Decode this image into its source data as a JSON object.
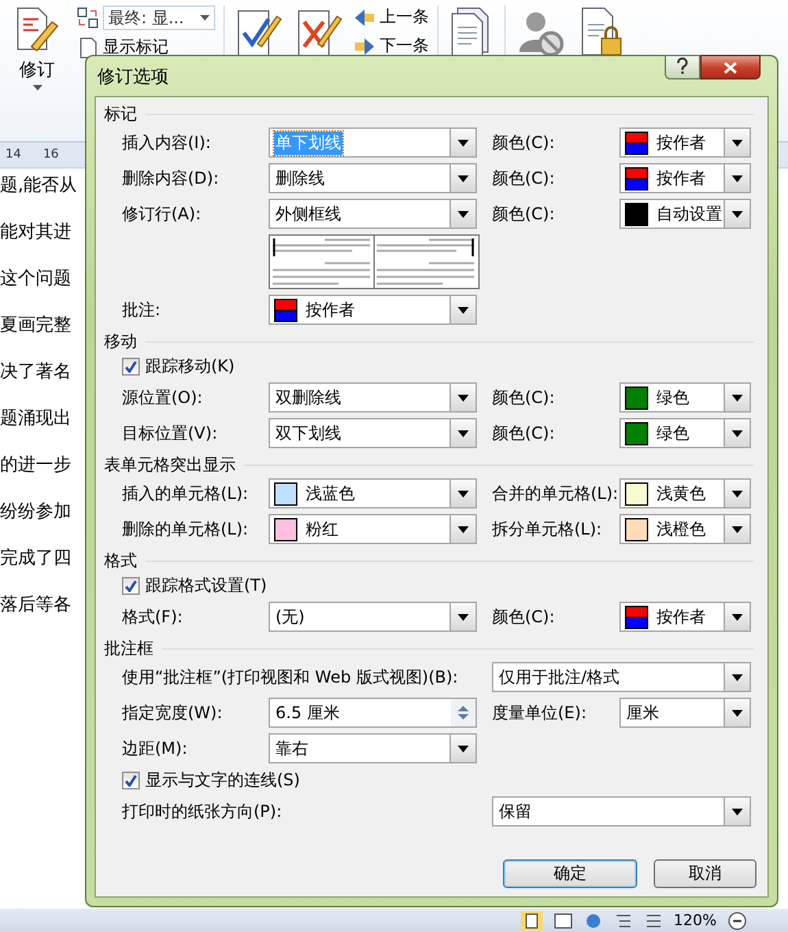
{
  "ribbon": {
    "track_button": {
      "label": "修订"
    },
    "markup_dropdown": {
      "value": "最终: 显..."
    },
    "show_markup": {
      "label": "显示标记"
    },
    "previous": {
      "label": "上一条"
    },
    "next": {
      "label": "下一条"
    }
  },
  "ruler": [
    "14",
    "16"
  ],
  "document_lines": [
    "题,能否从",
    "能对其进",
    "这个问题",
    "夏画完整",
    "决了著名",
    "题涌现出",
    "的进一步",
    "纷纷参加",
    "完成了四",
    "落后等各"
  ],
  "status_bar": {
    "zoom": "120%"
  },
  "dialog": {
    "title": "修订选项",
    "sections": [
      {
        "title": "标记",
        "rows": [
          {
            "kind": "pair",
            "label": "插入内容(I):",
            "field": {
              "value": "单下划线",
              "focused": true
            },
            "label2": "颜色(C):",
            "field2": {
              "value": "按作者",
              "swatch": {
                "kind": "split"
              }
            }
          },
          {
            "kind": "pair",
            "label": "删除内容(D):",
            "field": {
              "value": "删除线",
              "focused": false
            },
            "label2": "颜色(C):",
            "field2": {
              "value": "按作者",
              "swatch": {
                "kind": "split"
              }
            }
          },
          {
            "kind": "pair",
            "label": "修订行(A):",
            "field": {
              "value": "外侧框线",
              "focused": false
            },
            "label2": "颜色(C):",
            "field2": {
              "value": "自动设置",
              "swatch": {
                "kind": "solid",
                "color": "#000000"
              }
            }
          },
          {
            "kind": "preview"
          },
          {
            "kind": "single",
            "label": "批注:",
            "field": {
              "value": "按作者",
              "swatch": {
                "kind": "split"
              },
              "focused": false
            }
          }
        ]
      },
      {
        "title": "移动",
        "rows": [
          {
            "kind": "checkbox",
            "label": "跟踪移动(K)",
            "checked": true
          },
          {
            "kind": "pair",
            "label": "源位置(O):",
            "field": {
              "value": "双删除线",
              "focused": false
            },
            "label2": "颜色(C):",
            "field2": {
              "value": "绿色",
              "swatch": {
                "kind": "solid",
                "color": "#007f00"
              }
            }
          },
          {
            "kind": "pair",
            "label": "目标位置(V):",
            "field": {
              "value": "双下划线",
              "focused": false
            },
            "label2": "颜色(C):",
            "field2": {
              "value": "绿色",
              "swatch": {
                "kind": "solid",
                "color": "#007f00"
              }
            }
          }
        ]
      },
      {
        "title": "表单元格突出显示",
        "rows": [
          {
            "kind": "pair",
            "label": "插入的单元格(L):",
            "field": {
              "value": "浅蓝色",
              "swatch": {
                "kind": "solid",
                "color": "#c0e0ff"
              },
              "focused": false
            },
            "label2": "合并的单元格(L):",
            "field2": {
              "value": "浅黄色",
              "swatch": {
                "kind": "solid",
                "color": "#fafad2"
              }
            }
          },
          {
            "kind": "pair",
            "label": "删除的单元格(L):",
            "field": {
              "value": "粉红",
              "swatch": {
                "kind": "solid",
                "color": "#ffc0e0"
              },
              "focused": false
            },
            "label2": "拆分单元格(L):",
            "field2": {
              "value": "浅橙色",
              "swatch": {
                "kind": "solid",
                "color": "#ffdcb9"
              }
            }
          }
        ]
      },
      {
        "title": "格式",
        "rows": [
          {
            "kind": "checkbox",
            "label": "跟踪格式设置(T)",
            "checked": true
          },
          {
            "kind": "pair",
            "label": "格式(F):",
            "field": {
              "value": "(无)",
              "focused": false
            },
            "label2": "颜色(C):",
            "field2": {
              "value": "按作者",
              "swatch": {
                "kind": "split"
              }
            }
          }
        ]
      },
      {
        "title": "批注框",
        "rows": [
          {
            "kind": "wide",
            "label": "使用“批注框”(打印视图和 Web 版式视图)(B):",
            "field": {
              "value": "仅用于批注/格式",
              "focused": false
            }
          },
          {
            "kind": "pair",
            "label": "指定宽度(W):",
            "field": {
              "value": "6.5 厘米",
              "kind": "spin",
              "focused": false
            },
            "label2": "度量单位(E):",
            "field2": {
              "value": "厘米"
            }
          },
          {
            "kind": "single",
            "label": "边距(M):",
            "field": {
              "value": "靠右",
              "focused": false
            }
          },
          {
            "kind": "checkbox",
            "label": "显示与文字的连线(S)",
            "checked": true
          },
          {
            "kind": "wide",
            "label": "打印时的纸张方向(P):",
            "field": {
              "value": "保留",
              "focused": false
            }
          }
        ]
      }
    ],
    "buttons": [
      {
        "label": "确定",
        "default": true
      },
      {
        "label": "取消",
        "default": false
      }
    ]
  }
}
